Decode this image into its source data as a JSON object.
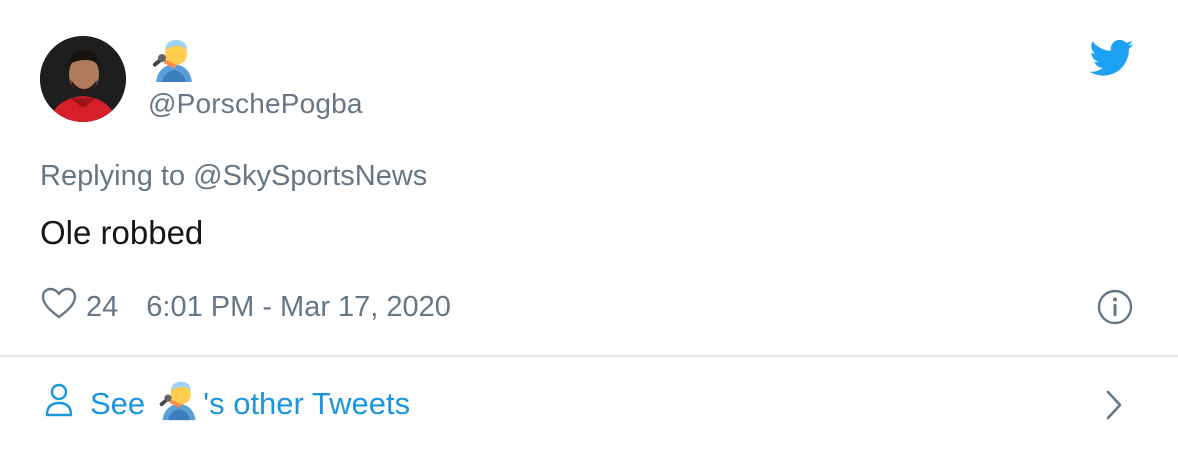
{
  "tweet": {
    "handle": "@PorschePogba",
    "display_name_icon": "singer-emoji-icon",
    "reply_prefix": "Replying to",
    "reply_to": "@SkySportsNews",
    "text": "Ole robbed",
    "likes": "24",
    "timestamp": "6:01 PM - Mar 17, 2020"
  },
  "footer": {
    "see_label": "See",
    "other_tweets_label": "'s other Tweets"
  },
  "colors": {
    "link": "#1b95e0",
    "muted": "#657786",
    "text": "#14171a",
    "divider": "#e1e8ed",
    "twitter_blue": "#1da1f2"
  }
}
